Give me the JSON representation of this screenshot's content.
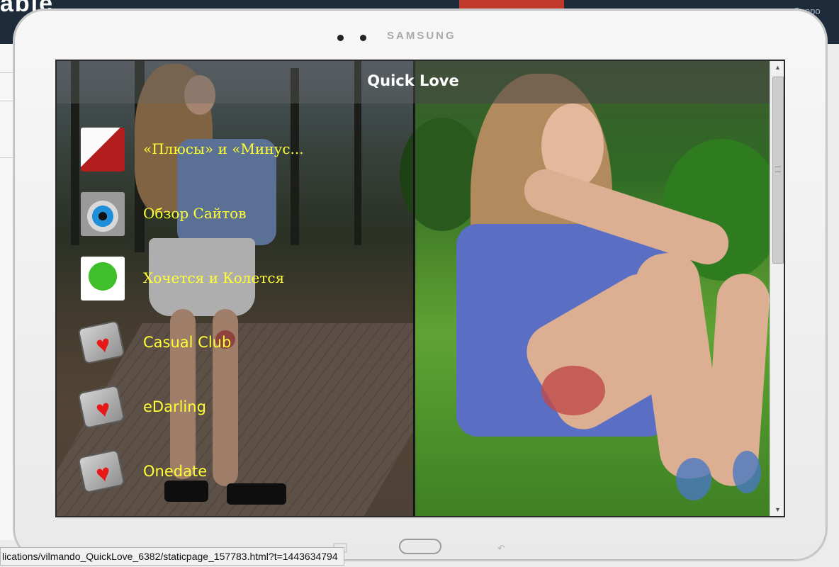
{
  "background_page": {
    "logo_fragment": "able",
    "support_fragment": "Suppo"
  },
  "device": {
    "brand": "SAMSUNG"
  },
  "app": {
    "title": "Quick Love",
    "menu_items": [
      {
        "label": "«Плюсы» и «Минус...",
        "icon": "woman-face-icon"
      },
      {
        "label": "Обзор Сайтов",
        "icon": "blue-eye-icon"
      },
      {
        "label": "Хочется и Колется",
        "icon": "green-apple-icon"
      },
      {
        "label": "Casual Club",
        "icon": "heart-tile-icon"
      },
      {
        "label": "eDarling",
        "icon": "heart-tile-icon"
      },
      {
        "label": "Onedate",
        "icon": "heart-tile-icon"
      }
    ]
  },
  "statusbar": {
    "url": "lications/vilmando_QuickLove_6382/staticpage_157783.html?t=1443634794"
  },
  "colors": {
    "menu_text": "#ffff33",
    "titlebar": "#464646"
  }
}
